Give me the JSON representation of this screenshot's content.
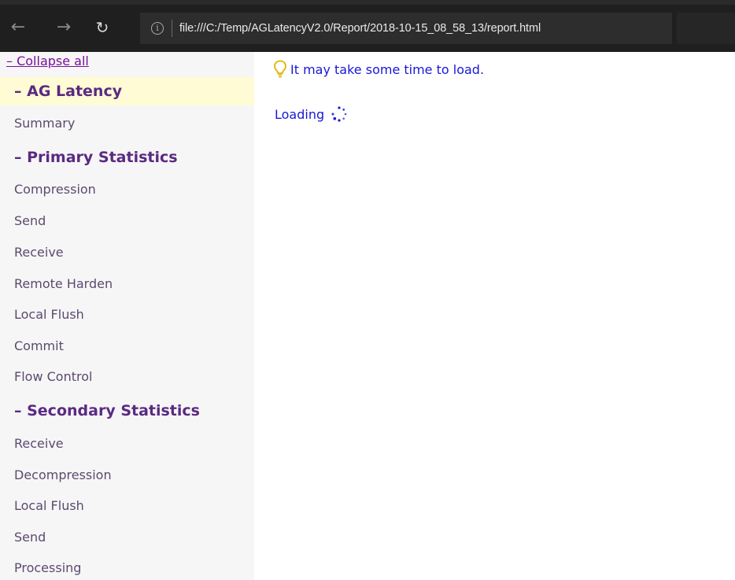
{
  "browser": {
    "back_glyph": "←",
    "forward_glyph": "→",
    "refresh_glyph": "↻",
    "info_glyph": "i",
    "url": "file:///C:/Temp/AGLatencyV2.0/Report/2018-10-15_08_58_13/report.html"
  },
  "sidebar": {
    "collapse_label": "– Collapse all",
    "sections": [
      {
        "title": "– AG Latency",
        "items": [
          "Summary"
        ]
      },
      {
        "title": "– Primary Statistics",
        "items": [
          "Compression",
          "Send",
          "Receive",
          "Remote Harden",
          "Local Flush",
          "Commit",
          "Flow Control"
        ]
      },
      {
        "title": "– Secondary Statistics",
        "items": [
          "Receive",
          "Decompression",
          "Local Flush",
          "Send",
          "Processing"
        ]
      }
    ]
  },
  "main": {
    "tip_text": "It may take some time to load.",
    "loading_text": "Loading"
  },
  "colors": {
    "link": "#7b0f99",
    "heading": "#5a2a82",
    "highlight": "#fffbd4",
    "main_text": "#1818d8",
    "bulb": "#e0b400"
  },
  "icons": {
    "back": "arrow-left-icon",
    "forward": "arrow-right-icon",
    "refresh": "refresh-icon",
    "info": "info-icon",
    "tip": "lightbulb-icon",
    "loading": "spinner-icon"
  }
}
